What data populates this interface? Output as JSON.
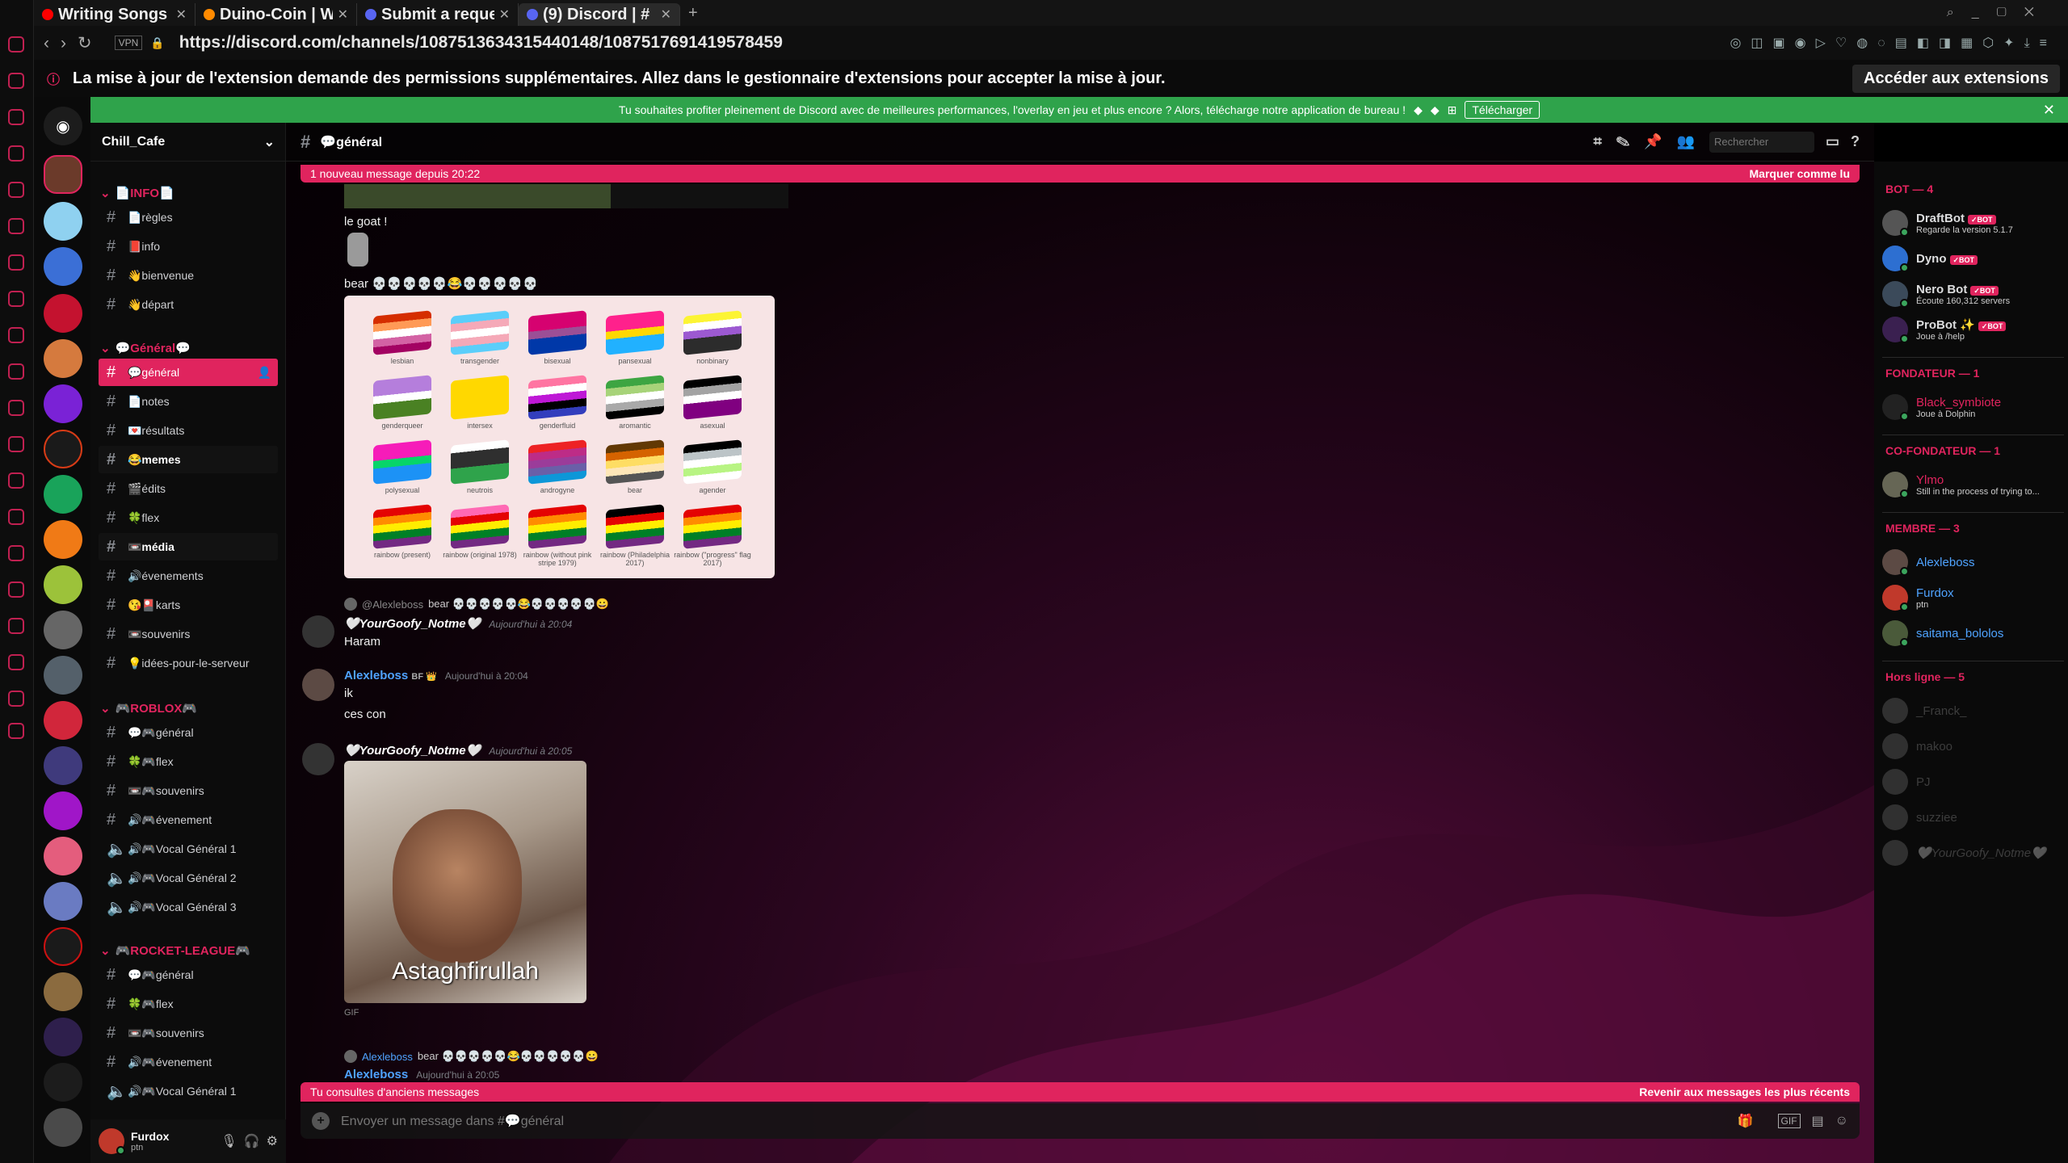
{
  "browser": {
    "tabs": [
      {
        "label": "Writing Songs",
        "color": "#ff0000",
        "active": false
      },
      {
        "label": "Duino-Coin | W",
        "color": "#ff8a00",
        "active": false
      },
      {
        "label": "Submit a reque",
        "color": "#5865f2",
        "active": false
      },
      {
        "label": "(9) Discord | #",
        "color": "#5865f2",
        "active": true
      }
    ],
    "url": "https://discord.com/channels/1087513634315440148/1087517691419578459",
    "vpn": "VPN",
    "notice": "La mise à jour de l'extension demande des permissions supplémentaires. Allez dans le gestionnaire d'extensions pour accepter la mise à jour.",
    "notice_button": "Accéder aux extensions"
  },
  "banner": {
    "text": "Tu souhaites profiter pleinement de Discord avec de meilleures performances, l'overlay en jeu et plus encore ? Alors, télécharge notre application de bureau !",
    "button": "Télécharger"
  },
  "server": {
    "name": "Chill_Cafe",
    "categories": [
      {
        "name": "📄INFO📄",
        "channels": [
          "📄règles",
          "📕info",
          "👋bienvenue",
          "👋départ"
        ]
      },
      {
        "name": "💬Général💬",
        "channels": [
          "💬général",
          "📄notes",
          "💌résultats",
          "😂memes",
          "🎬édits",
          "🍀flex",
          "📼média",
          "🔊évenements",
          "😘🎴karts",
          "📼souvenirs",
          "💡idées-pour-le-serveur"
        ]
      },
      {
        "name": "🎮ROBLOX🎮",
        "channels": [
          "💬🎮général",
          "🍀🎮flex",
          "📼🎮souvenirs",
          "🔊🎮évenement",
          "🔊🎮Vocal Général 1",
          "🔊🎮Vocal Général 2",
          "🔊🎮Vocal Général 3"
        ]
      },
      {
        "name": "🎮ROCKET-LEAGUE🎮",
        "channels": [
          "💬🎮général",
          "🍀🎮flex",
          "📼🎮souvenirs",
          "🔊🎮évenement",
          "🔊🎮Vocal Général 1"
        ]
      }
    ]
  },
  "user": {
    "name": "Furdox",
    "status": "ptn"
  },
  "channel": {
    "name": "💬général",
    "search_placeholder": "Rechercher",
    "composer_placeholder": "Envoyer un message dans #💬général"
  },
  "new_messages": {
    "text": "1 nouveau message depuis 20:22",
    "action": "Marquer comme lu"
  },
  "old_messages": {
    "text": "Tu consultes d'anciens messages",
    "action": "Revenir aux messages les plus récents"
  },
  "messages": {
    "m1": "le goat !",
    "m2": "bear 💀💀💀💀💀😂💀💀💀💀💀",
    "flags": [
      "lesbian",
      "transgender",
      "bisexual",
      "pansexual",
      "nonbinary",
      "genderqueer",
      "intersex",
      "genderfluid",
      "aromantic",
      "asexual",
      "polysexual",
      "neutrois",
      "androgyne",
      "bear",
      "agender",
      "rainbow (present)",
      "rainbow (original 1978)",
      "rainbow (without pink stripe 1979)",
      "rainbow (Philadelphia 2017)",
      "rainbow (\"progress\" flag 2017)"
    ],
    "r1_author": "@Alexleboss",
    "r1_text": "bear 💀💀💀💀💀😂💀💀💀💀💀😀",
    "a1": "🤍YourGoofy_Notme🤍",
    "a1_ts": "Aujourd'hui à 20:04",
    "a1_text": "Haram",
    "a2": "Alexleboss",
    "a2_ts": "Aujourd'hui à 20:04",
    "a2_t1": "ik",
    "a2_t2": "ces con",
    "a3": "🤍YourGoofy_Notme🤍",
    "a3_ts": "Aujourd'hui à 20:05",
    "gif_caption": "Astaghfirullah",
    "gif_label": "GIF",
    "r2_author": "Alexleboss",
    "r2_text": "bear 💀💀💀💀💀😂💀💀💀💀💀😀",
    "a4": "Alexleboss",
    "a4_ts": "Aujourd'hui à 20:05"
  },
  "members": {
    "bot_header": "BOT — 4",
    "bots": [
      {
        "name": "DraftBot",
        "status": "Regarde la version 5.1.7"
      },
      {
        "name": "Dyno",
        "status": ""
      },
      {
        "name": "Nero Bot",
        "status": "Écoute 160,312 servers"
      },
      {
        "name": "ProBot ✨",
        "status": "Joue à /help"
      }
    ],
    "bot_tag": "✓BOT",
    "fond_header": "FONDATEUR — 1",
    "fond": {
      "name": "Black_symbiote",
      "status": "Joue à Dolphin"
    },
    "cofond_header": "CO-FONDATEUR — 1",
    "cofond": {
      "name": "Ylmo",
      "status": "Still in the process of trying to..."
    },
    "membre_header": "MEMBRE — 3",
    "membres": [
      {
        "name": "Alexleboss",
        "status": ""
      },
      {
        "name": "Furdox",
        "status": "ptn"
      },
      {
        "name": "saitama_bololos",
        "status": ""
      }
    ],
    "offline_header": "Hors ligne — 5",
    "offline": [
      "_Franck_",
      "makoo",
      "PJ",
      "suzziee",
      "🤍YourGoofy_Notme🤍"
    ]
  },
  "colors": {
    "accent": "#e0245e",
    "online": "#3ba55d",
    "banner": "#2fa34b"
  }
}
